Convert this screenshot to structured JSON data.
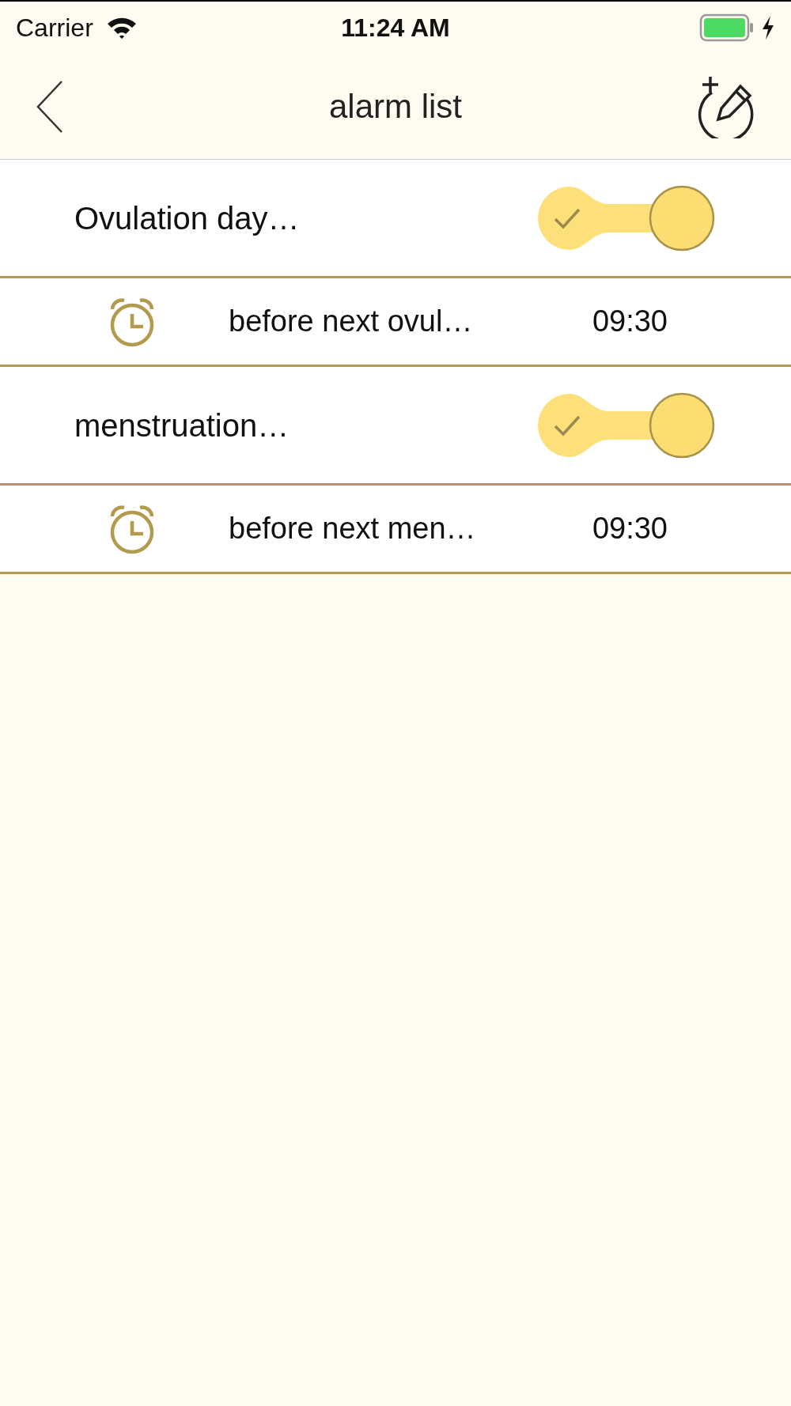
{
  "status_bar": {
    "carrier": "Carrier",
    "time": "11:24 AM"
  },
  "nav": {
    "title": "alarm list"
  },
  "groups": [
    {
      "title": "Ovulation day…",
      "on": true,
      "alarm": {
        "label": "before next ovul…",
        "time": "09:30"
      }
    },
    {
      "title": "menstruation…",
      "on": true,
      "alarm": {
        "label": "before next men…",
        "time": "09:30"
      }
    }
  ]
}
